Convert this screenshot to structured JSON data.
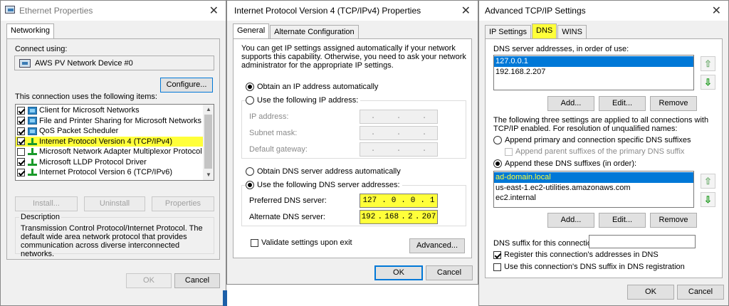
{
  "ethernet": {
    "title": "Ethernet Properties",
    "tab": "Networking",
    "connect_using_label": "Connect using:",
    "adapter": "AWS PV Network Device #0",
    "configure_label": "Configure...",
    "items_label": "This connection uses the following items:",
    "items": [
      {
        "label": "Client for Microsoft Networks",
        "icon": "network-client-icon",
        "checked": true
      },
      {
        "label": "File and Printer Sharing for Microsoft Networks",
        "icon": "network-client-icon",
        "checked": true
      },
      {
        "label": "QoS Packet Scheduler",
        "icon": "network-client-icon",
        "checked": true
      },
      {
        "label": "Internet Protocol Version 4 (TCP/IPv4)",
        "icon": "protocol-icon",
        "checked": true
      },
      {
        "label": "Microsoft Network Adapter Multiplexor Protocol",
        "icon": "protocol-icon",
        "checked": false
      },
      {
        "label": "Microsoft LLDP Protocol Driver",
        "icon": "protocol-icon",
        "checked": true
      },
      {
        "label": "Internet Protocol Version 6 (TCP/IPv6)",
        "icon": "protocol-icon",
        "checked": true
      }
    ],
    "install_label": "Install...",
    "uninstall_label": "Uninstall",
    "properties_label": "Properties",
    "description_title": "Description",
    "description_text": "Transmission Control Protocol/Internet Protocol. The default wide area network protocol that provides communication across diverse interconnected networks.",
    "ok_label": "OK",
    "cancel_label": "Cancel"
  },
  "ipv4": {
    "title": "Internet Protocol Version 4 (TCP/IPv4) Properties",
    "tab_general": "General",
    "tab_alternate": "Alternate Configuration",
    "intro": "You can get IP settings assigned automatically if your network supports this capability. Otherwise, you need to ask your network administrator for the appropriate IP settings.",
    "obtain_ip_auto": "Obtain an IP address automatically",
    "use_following_ip": "Use the following IP address:",
    "ip_address_label": "IP address:",
    "subnet_mask_label": "Subnet mask:",
    "default_gateway_label": "Default gateway:",
    "obtain_dns_auto": "Obtain DNS server address automatically",
    "use_following_dns": "Use the following DNS server addresses:",
    "preferred_dns_label": "Preferred DNS server:",
    "preferred_dns": [
      "127",
      "0",
      "0",
      "1"
    ],
    "alternate_dns_label": "Alternate DNS server:",
    "alternate_dns": [
      "192",
      "168",
      "2",
      "207"
    ],
    "validate_label": "Validate settings upon exit",
    "advanced_label": "Advanced...",
    "ok_label": "OK",
    "cancel_label": "Cancel"
  },
  "advanced": {
    "title": "Advanced TCP/IP Settings",
    "tab_ip": "IP Settings",
    "tab_dns": "DNS",
    "tab_wins": "WINS",
    "dns_servers_label": "DNS server addresses, in order of use:",
    "dns_servers": [
      "127.0.0.1",
      "192.168.2.207"
    ],
    "add_label": "Add...",
    "edit_label": "Edit...",
    "remove_label": "Remove",
    "three_settings_text": "The following three settings are applied to all connections with TCP/IP enabled. For resolution of unqualified names:",
    "append_primary_label": "Append primary and connection specific DNS suffixes",
    "append_parent_label": "Append parent suffixes of the primary DNS suffix",
    "append_these_label": "Append these DNS suffixes (in order):",
    "suffixes": [
      "ad-domain.local",
      "us-east-1.ec2-utilities.amazonaws.com",
      "ec2.internal"
    ],
    "dns_suffix_label": "DNS suffix for this connection:",
    "dns_suffix_value": "",
    "register_label": "Register this connection's addresses in DNS",
    "use_suffix_label": "Use this connection's DNS suffix in DNS registration",
    "ok_label": "OK",
    "cancel_label": "Cancel"
  },
  "colors": {
    "highlight": "#ffff3a",
    "selection": "#0078d7",
    "dialog_bg": "#f0f0f0"
  }
}
